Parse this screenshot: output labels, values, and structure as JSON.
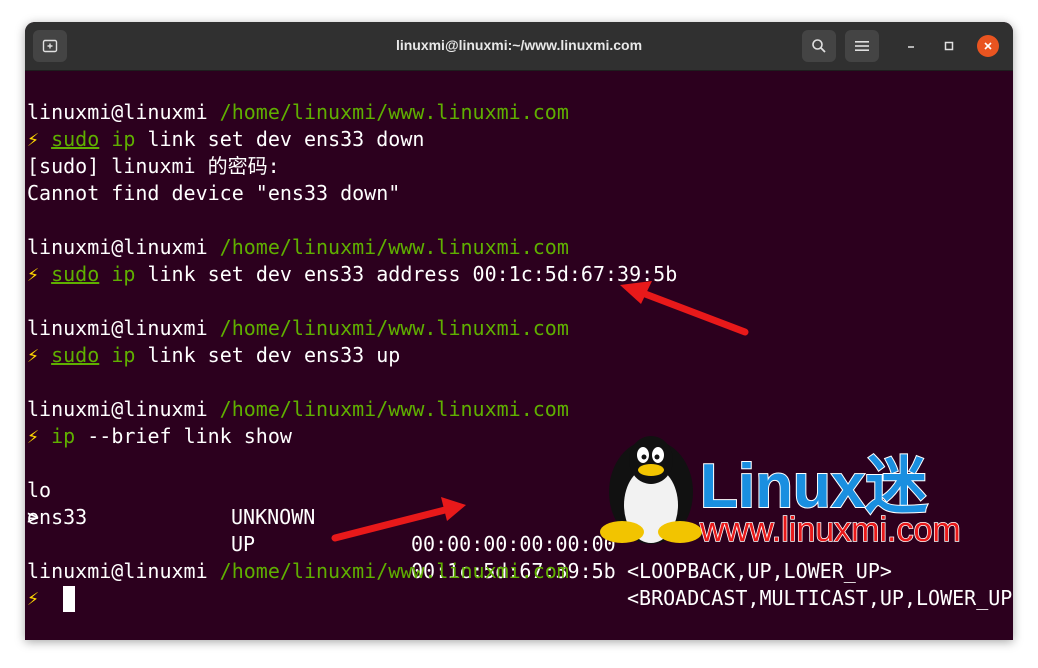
{
  "window": {
    "title": "linuxmi@linuxmi:~/www.linuxmi.com"
  },
  "prompt": {
    "user": "linuxmi@linuxmi",
    "path": "/home/linuxmi/www.linuxmi.com",
    "symbol": "⚡"
  },
  "commands": {
    "c1": {
      "sudo": "sudo",
      "ip": "ip",
      "rest": "link set dev ens33 down"
    },
    "c1_out1": "[sudo] linuxmi 的密码:",
    "c1_out2": "Cannot find device \"ens33 down\"",
    "c2": {
      "sudo": "sudo",
      "ip": "ip",
      "rest": "link set dev ens33 address 00:1c:5d:67:39:5b"
    },
    "c3": {
      "sudo": "sudo",
      "ip": "ip",
      "rest": "link set dev ens33 up"
    },
    "c4": {
      "ip": "ip",
      "rest": "--brief link show"
    }
  },
  "link_table": [
    {
      "name": "lo",
      "state": "UNKNOWN",
      "mac": "00:00:00:00:00:00",
      "flags": "<LOOPBACK,UP,LOWER_UP>"
    },
    {
      "name": "ens33",
      "state": "UP",
      "mac": "00:1c:5d:67:39:5b",
      "flags": "<BROADCAST,MULTICAST,UP,LOWER_UP"
    }
  ],
  "wrap_line": ">",
  "watermark": {
    "brand": "Linux迷",
    "url": "www.linuxmi.com"
  },
  "colors": {
    "background": "#2c001e",
    "prompt_path": "#5faf00",
    "bolt": "#ffd700",
    "arrow": "#e8191a",
    "brand": "#1a8fe0",
    "close": "#e95420"
  },
  "icons": [
    "new-tab-icon",
    "search-icon",
    "menu-icon",
    "minimize-icon",
    "maximize-icon",
    "close-icon",
    "lightning-icon",
    "arrow-annotation",
    "tux-logo"
  ]
}
